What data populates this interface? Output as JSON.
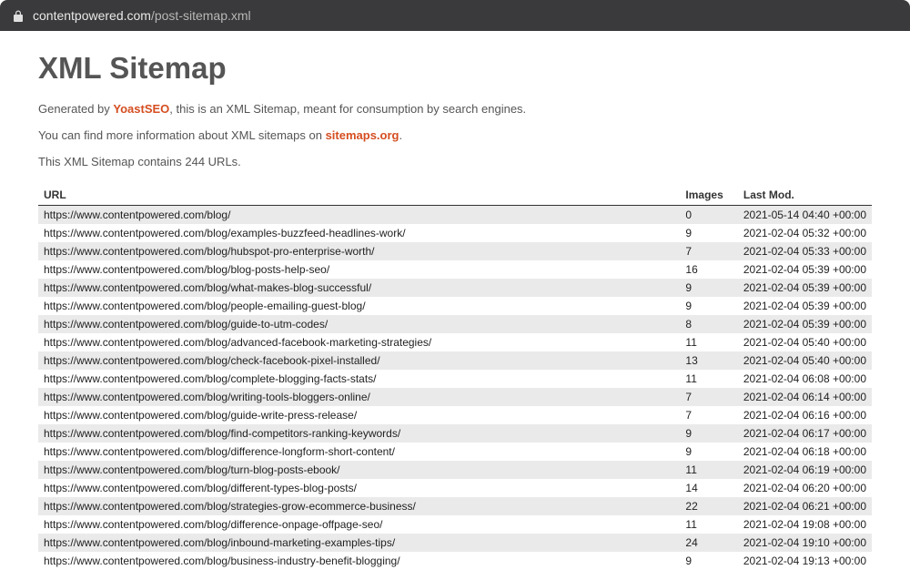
{
  "browser": {
    "domain": "contentpowered.com",
    "path": "/post-sitemap.xml"
  },
  "page": {
    "title": "XML Sitemap",
    "generated_prefix": "Generated by ",
    "generated_link": "YoastSEO",
    "generated_suffix": ", this is an XML Sitemap, meant for consumption by search engines.",
    "info_prefix": "You can find more information about XML sitemaps on ",
    "info_link": "sitemaps.org",
    "info_suffix": ".",
    "url_count_text": "This XML Sitemap contains 244 URLs."
  },
  "table": {
    "headers": {
      "url": "URL",
      "images": "Images",
      "lastmod": "Last Mod."
    },
    "rows": [
      {
        "url": "https://www.contentpowered.com/blog/",
        "images": "0",
        "lastmod": "2021-05-14 04:40 +00:00"
      },
      {
        "url": "https://www.contentpowered.com/blog/examples-buzzfeed-headlines-work/",
        "images": "9",
        "lastmod": "2021-02-04 05:32 +00:00"
      },
      {
        "url": "https://www.contentpowered.com/blog/hubspot-pro-enterprise-worth/",
        "images": "7",
        "lastmod": "2021-02-04 05:33 +00:00"
      },
      {
        "url": "https://www.contentpowered.com/blog/blog-posts-help-seo/",
        "images": "16",
        "lastmod": "2021-02-04 05:39 +00:00"
      },
      {
        "url": "https://www.contentpowered.com/blog/what-makes-blog-successful/",
        "images": "9",
        "lastmod": "2021-02-04 05:39 +00:00"
      },
      {
        "url": "https://www.contentpowered.com/blog/people-emailing-guest-blog/",
        "images": "9",
        "lastmod": "2021-02-04 05:39 +00:00"
      },
      {
        "url": "https://www.contentpowered.com/blog/guide-to-utm-codes/",
        "images": "8",
        "lastmod": "2021-02-04 05:39 +00:00"
      },
      {
        "url": "https://www.contentpowered.com/blog/advanced-facebook-marketing-strategies/",
        "images": "11",
        "lastmod": "2021-02-04 05:40 +00:00"
      },
      {
        "url": "https://www.contentpowered.com/blog/check-facebook-pixel-installed/",
        "images": "13",
        "lastmod": "2021-02-04 05:40 +00:00"
      },
      {
        "url": "https://www.contentpowered.com/blog/complete-blogging-facts-stats/",
        "images": "11",
        "lastmod": "2021-02-04 06:08 +00:00"
      },
      {
        "url": "https://www.contentpowered.com/blog/writing-tools-bloggers-online/",
        "images": "7",
        "lastmod": "2021-02-04 06:14 +00:00"
      },
      {
        "url": "https://www.contentpowered.com/blog/guide-write-press-release/",
        "images": "7",
        "lastmod": "2021-02-04 06:16 +00:00"
      },
      {
        "url": "https://www.contentpowered.com/blog/find-competitors-ranking-keywords/",
        "images": "9",
        "lastmod": "2021-02-04 06:17 +00:00"
      },
      {
        "url": "https://www.contentpowered.com/blog/difference-longform-short-content/",
        "images": "9",
        "lastmod": "2021-02-04 06:18 +00:00"
      },
      {
        "url": "https://www.contentpowered.com/blog/turn-blog-posts-ebook/",
        "images": "11",
        "lastmod": "2021-02-04 06:19 +00:00"
      },
      {
        "url": "https://www.contentpowered.com/blog/different-types-blog-posts/",
        "images": "14",
        "lastmod": "2021-02-04 06:20 +00:00"
      },
      {
        "url": "https://www.contentpowered.com/blog/strategies-grow-ecommerce-business/",
        "images": "22",
        "lastmod": "2021-02-04 06:21 +00:00"
      },
      {
        "url": "https://www.contentpowered.com/blog/difference-onpage-offpage-seo/",
        "images": "11",
        "lastmod": "2021-02-04 19:08 +00:00"
      },
      {
        "url": "https://www.contentpowered.com/blog/inbound-marketing-examples-tips/",
        "images": "24",
        "lastmod": "2021-02-04 19:10 +00:00"
      },
      {
        "url": "https://www.contentpowered.com/blog/business-industry-benefit-blogging/",
        "images": "9",
        "lastmod": "2021-02-04 19:13 +00:00"
      }
    ]
  }
}
